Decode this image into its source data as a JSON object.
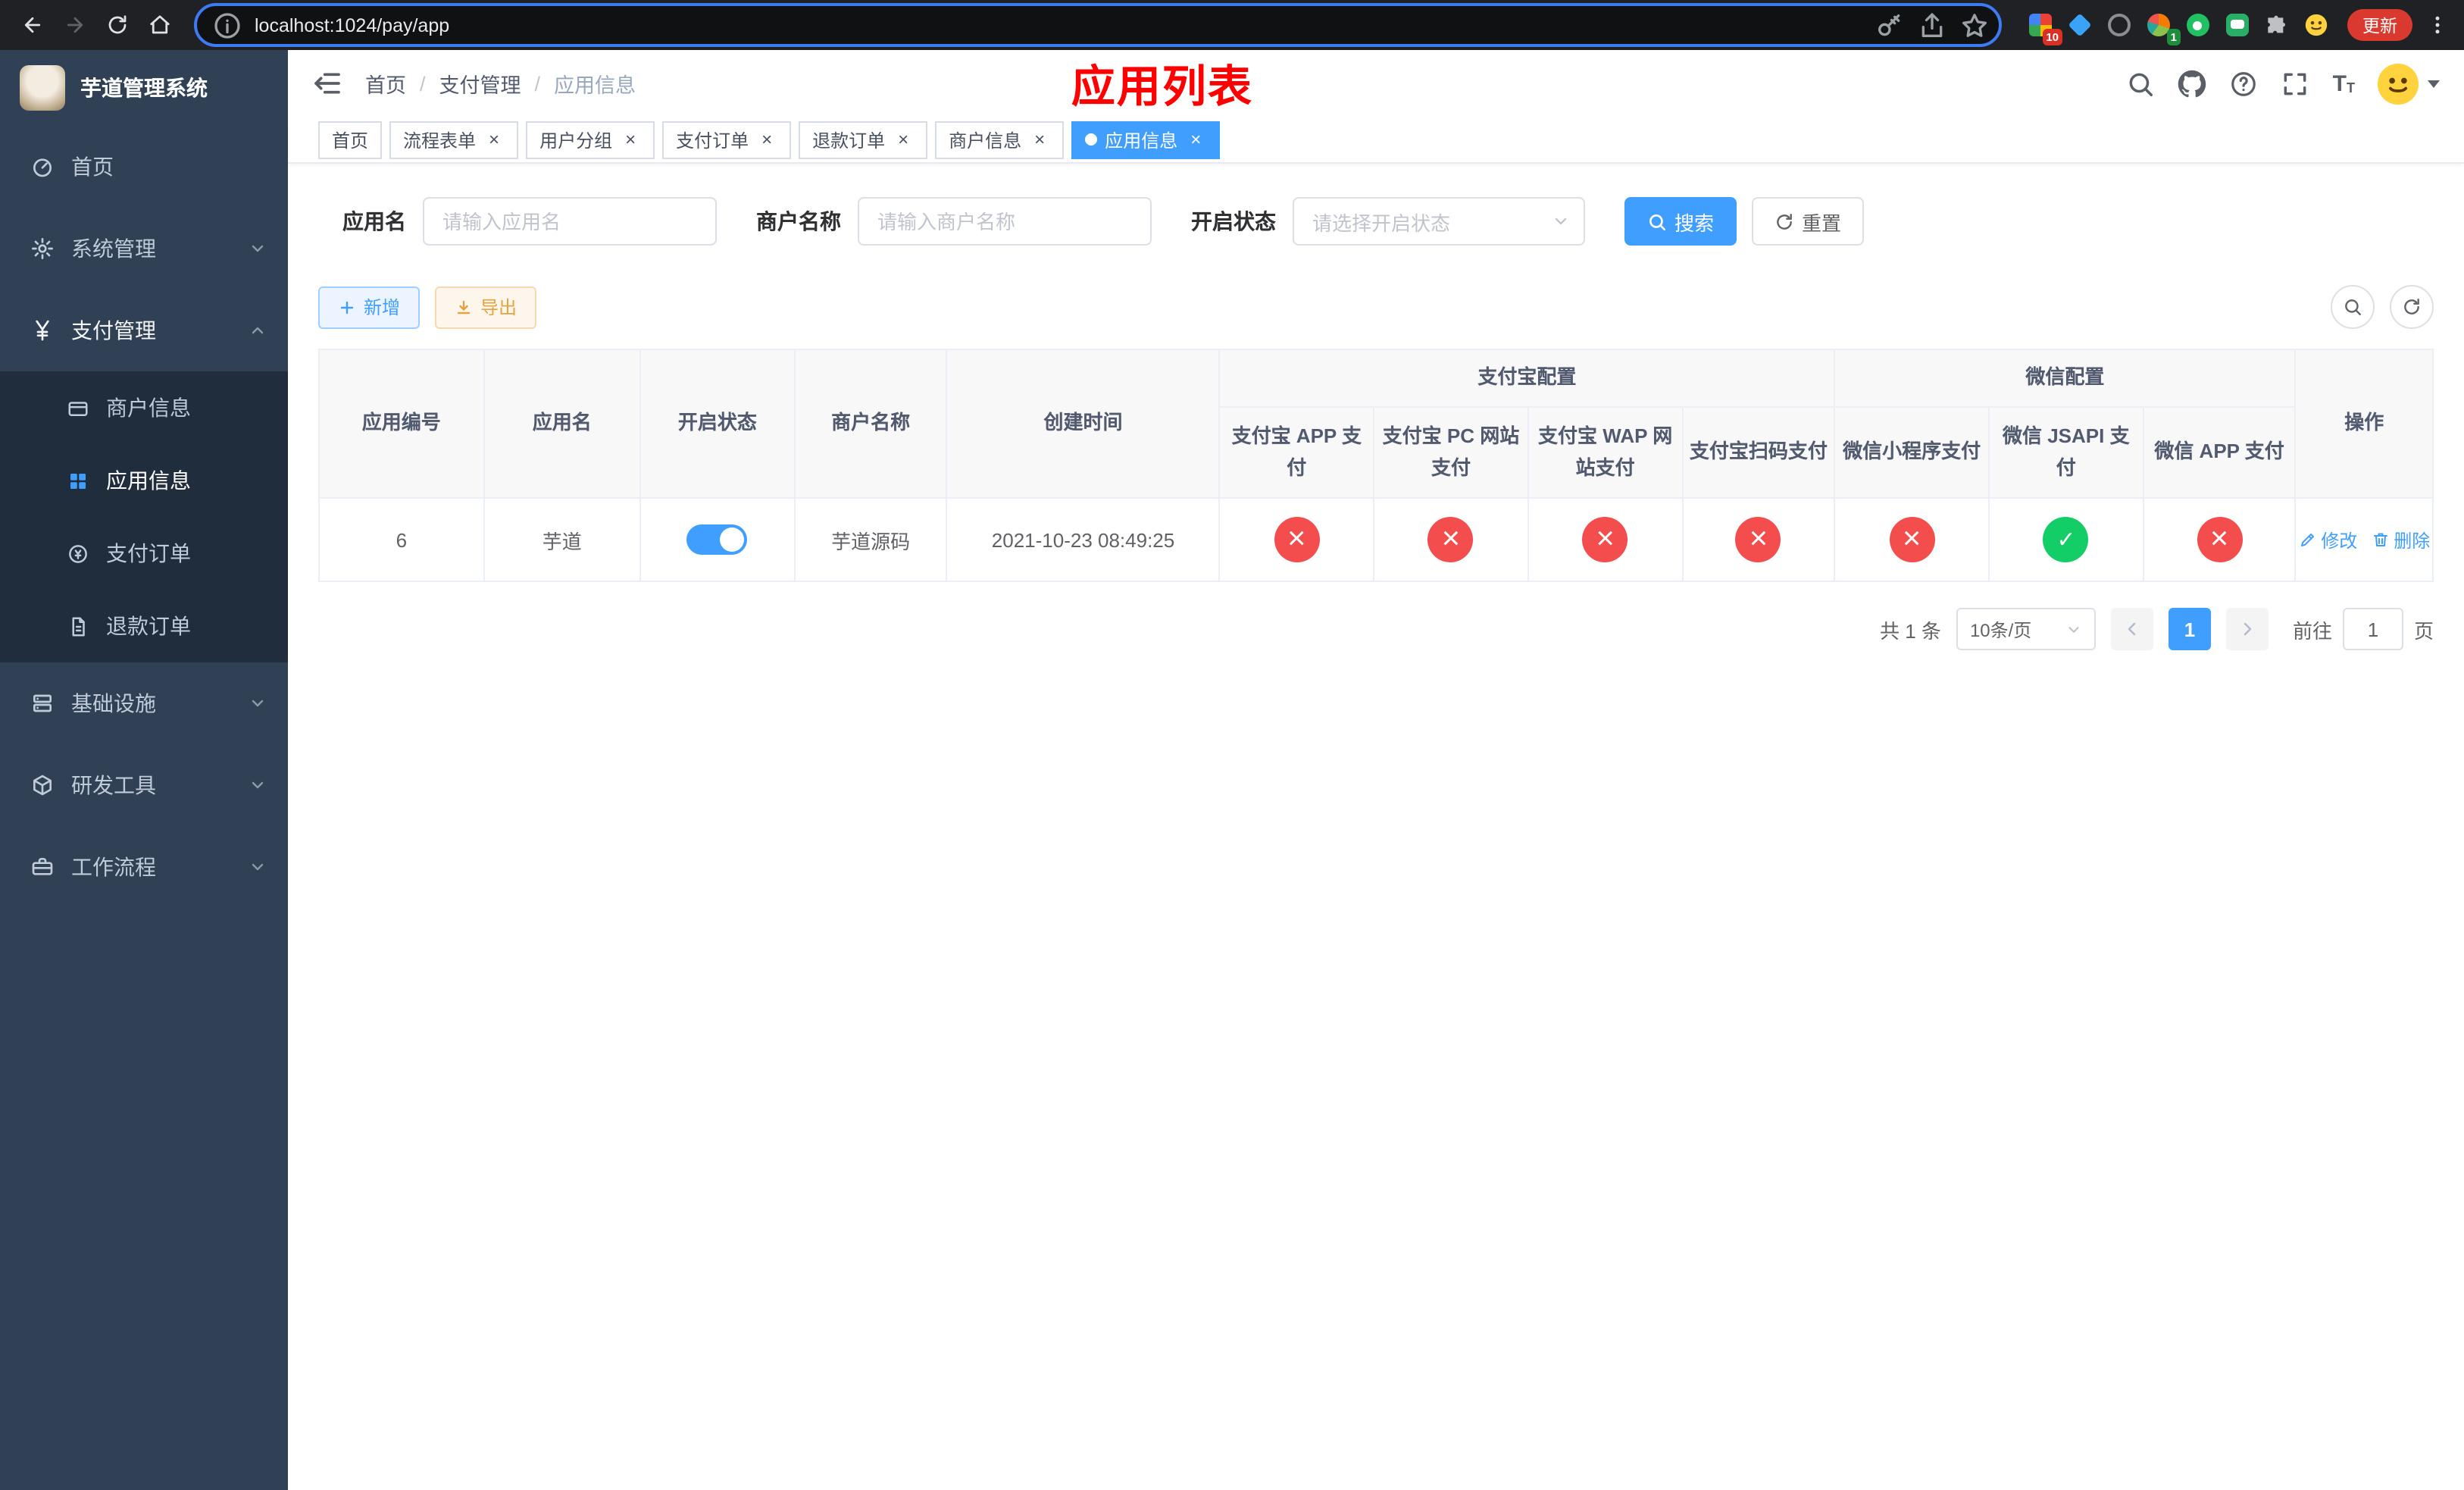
{
  "browser": {
    "url": "localhost:1024/pay/app",
    "update_label": "更新",
    "extension_badge": "10",
    "avatar_badge": "1"
  },
  "sidebar": {
    "title": "芋道管理系统",
    "home": "首页",
    "system": "系统管理",
    "payment": "支付管理",
    "merchant_info": "商户信息",
    "app_info": "应用信息",
    "pay_order": "支付订单",
    "refund_order": "退款订单",
    "infra": "基础设施",
    "dev_tools": "研发工具",
    "workflow": "工作流程"
  },
  "header": {
    "breadcrumb": [
      "首页",
      "支付管理",
      "应用信息"
    ],
    "overlay_title": "应用列表"
  },
  "tabs": [
    {
      "label": "首页"
    },
    {
      "label": "流程表单"
    },
    {
      "label": "用户分组"
    },
    {
      "label": "支付订单"
    },
    {
      "label": "退款订单"
    },
    {
      "label": "商户信息"
    },
    {
      "label": "应用信息"
    }
  ],
  "filters": {
    "app_name_label": "应用名",
    "app_name_placeholder": "请输入应用名",
    "merchant_label": "商户名称",
    "merchant_placeholder": "请输入商户名称",
    "status_label": "开启状态",
    "status_placeholder": "请选择开启状态",
    "search_button": "搜索",
    "reset_button": "重置"
  },
  "toolbar": {
    "add_button": "新增",
    "export_button": "导出"
  },
  "table": {
    "col_app_id": "应用编号",
    "col_app_name": "应用名",
    "col_status": "开启状态",
    "col_merchant": "商户名称",
    "col_create_time": "创建时间",
    "group_alipay": "支付宝配置",
    "group_wechat": "微信配置",
    "col_actions": "操作",
    "config_headers": [
      "支付宝 APP 支付",
      "支付宝 PC 网站支付",
      "支付宝 WAP 网站支付",
      "支付宝扫码支付",
      "微信小程序支付",
      "微信 JSAPI 支付",
      "微信 APP 支付"
    ],
    "row": {
      "app_id": "6",
      "app_name": "芋道",
      "status_on": true,
      "merchant": "芋道源码",
      "create_time": "2021-10-23 08:49:25",
      "configs": [
        "off",
        "off",
        "off",
        "off",
        "off",
        "on",
        "off"
      ],
      "edit_label": "修改",
      "delete_label": "删除"
    }
  },
  "pagination": {
    "total": "共 1 条",
    "page_size": "10条/页",
    "page": "1",
    "goto_label": "前往",
    "goto_value": "1",
    "goto_unit": "页"
  },
  "colors": {
    "accent": "#409EFF",
    "danger": "#F34D4D",
    "success": "#13CE66",
    "sidebar_bg": "#304156",
    "submenu_bg": "#1F2D3D",
    "overlay_title": "#FF0000"
  }
}
